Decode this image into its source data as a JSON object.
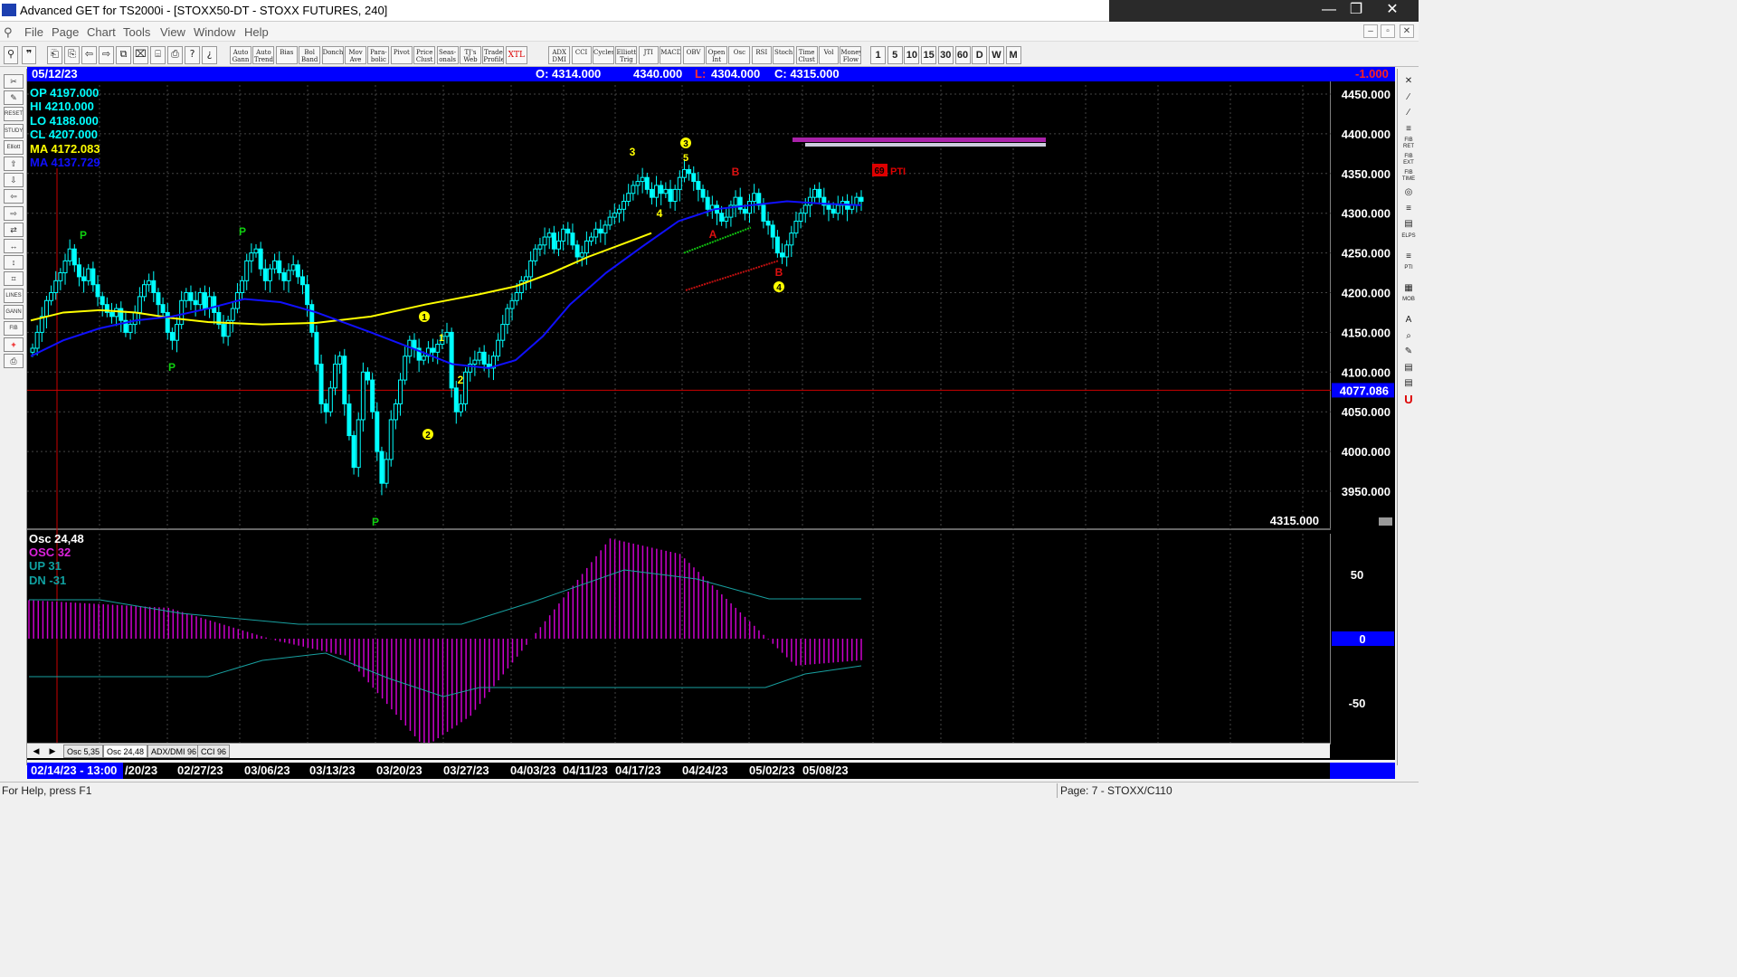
{
  "window": {
    "title": "Advanced GET for TS2000i - [STOXX50-DT - STOXX FUTURES, 240]",
    "minimize": "—",
    "maximize": "❐",
    "close": "✕"
  },
  "menu": [
    "File",
    "Page",
    "Chart",
    "Tools",
    "View",
    "Window",
    "Help"
  ],
  "toolbar": {
    "icon_buttons": [
      "⎗",
      "⎘",
      "⇦",
      "⇨",
      "⧉",
      "⌧",
      "⌸",
      "⎙",
      "?",
      "¿"
    ],
    "studies": [
      "Auto Gann",
      "Auto Trend",
      "Bias",
      "Bol Band",
      "Donch",
      "Mov Ave",
      "Para- bolic",
      "Pivot",
      "Price Clust",
      "Seas- onals",
      "TJ's Web",
      "Trade Profile",
      "XTL",
      "ADX DMI",
      "CCI",
      "Cycles",
      "Elliott Trig",
      "JTI",
      "MACD",
      "OBV",
      "Open Int",
      "Osc",
      "RSI",
      "Stoch",
      "Time Clust",
      "Vol",
      "Money Flow"
    ],
    "timeframes": [
      "1",
      "5",
      "10",
      "15",
      "30",
      "60",
      "D",
      "W",
      "M"
    ]
  },
  "infobar": {
    "date": "05/12/23",
    "open": "O: 4314.000",
    "high": "4340.000",
    "low_label": "L:",
    "low": "4304.000",
    "close": "C: 4315.000",
    "change": "-1.000"
  },
  "indicators": {
    "op": "OP  4197.000",
    "hi": "HI   4210.000",
    "lo": "LO  4188.000",
    "cl": "CL  4207.000",
    "ma1": "MA  4172.083",
    "ma2": "MA  4137.729"
  },
  "price_axis": [
    "4450.000",
    "4400.000",
    "4350.000",
    "4300.000",
    "4250.000",
    "4200.000",
    "4150.000",
    "4100.000",
    "4050.000",
    "4000.000",
    "3950.000"
  ],
  "price_marker": "4077.086",
  "last_price": "4315.000",
  "pti_value": "69",
  "pti_label": "PTI",
  "elliott": {
    "one": "1",
    "two": "2",
    "three": "3",
    "four": "4",
    "five": "5",
    "a": "A",
    "b": "B",
    "p": "P"
  },
  "osc_panel": {
    "title": "Osc 24,48",
    "osc": "OSC 32",
    "up": "UP   31",
    "dn": "DN  -31",
    "axis": [
      "50",
      "0",
      "-50"
    ]
  },
  "tabs": [
    "Osc 5,35",
    "Osc 24,48",
    "ADX/DMI 96",
    "CCI 96"
  ],
  "tab_nav": [
    "◀",
    "▶"
  ],
  "dates": [
    "02/14/23 - 13:00",
    "/20/23",
    "02/27/23",
    "03/06/23",
    "03/13/23",
    "03/20/23",
    "03/27/23",
    "04/03/23",
    "04/11/23",
    "04/17/23",
    "04/24/23",
    "05/02/23",
    "05/08/23"
  ],
  "status": {
    "help": "For Help, press F1",
    "page": "Page: 7 - STOXX/C110"
  },
  "left_tools": [
    "✂",
    "✎",
    "RESET",
    "STUDY",
    "Elliott",
    "⇧",
    "⇩",
    "⇦",
    "⇨",
    "⇄",
    "↔",
    "↕",
    "⌗",
    "LINES",
    "GANN",
    "FIB",
    "+",
    "⎙"
  ],
  "right_tools": [
    "✕",
    "∕",
    "∕",
    "≡",
    "FIB RET",
    "FIB EXT",
    "FIB TIME",
    "◎",
    "≡",
    "▤",
    "ELPS",
    "≡",
    "PTI",
    "▦",
    "MOB",
    "A",
    "⌕",
    "✎",
    "▤",
    "▤",
    "U"
  ],
  "colors": {
    "background": "#000000",
    "candles": "#00ffff",
    "ma_fast": "#ffff00",
    "ma_slow": "#1010ff",
    "osc_histogram": "#cc00cc",
    "infobar": "#0000ff"
  }
}
